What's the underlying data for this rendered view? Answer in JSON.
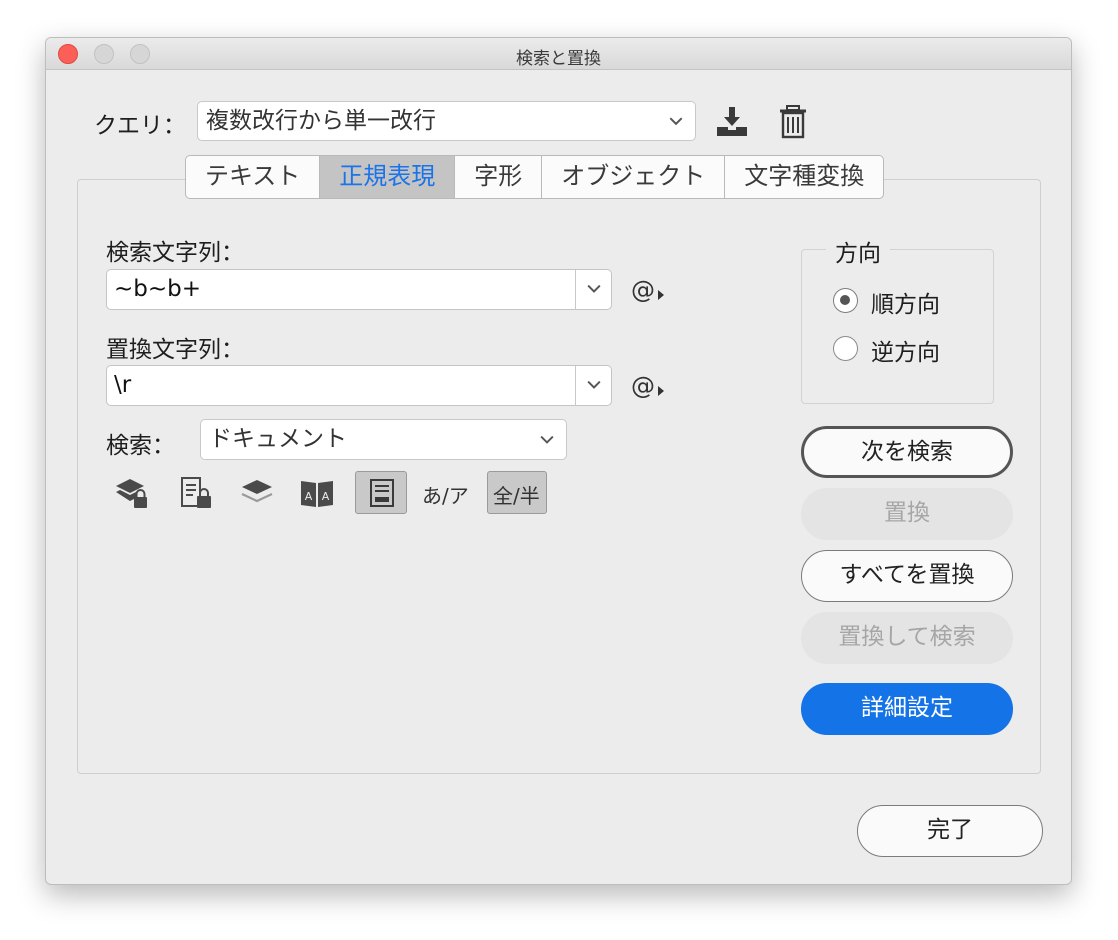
{
  "window": {
    "title": "検索と置換"
  },
  "query": {
    "label": "クエリ：",
    "value": "複数改行から単一改行",
    "save_icon": "save-download-icon",
    "delete_icon": "trash-icon"
  },
  "tabs": [
    {
      "label": "テキスト",
      "active": false
    },
    {
      "label": "正規表現",
      "active": true
    },
    {
      "label": "字形",
      "active": false
    },
    {
      "label": "オブジェクト",
      "active": false
    },
    {
      "label": "文字種変換",
      "active": false
    }
  ],
  "find": {
    "label": "検索文字列：",
    "value": "~b~b+",
    "special_chars": "@"
  },
  "replace": {
    "label": "置換文字列：",
    "value": "\\r",
    "special_chars": "@"
  },
  "search": {
    "label": "検索：",
    "value": "ドキュメント"
  },
  "options": {
    "kana_label": "あ/ア",
    "width_label": "全/半",
    "icons": [
      "locked-layers-icon",
      "locked-stories-icon",
      "hidden-layers-icon",
      "master-pages-icon",
      "footnotes-icon"
    ]
  },
  "direction": {
    "title": "方向",
    "forward": "順方向",
    "backward": "逆方向",
    "selected": "forward"
  },
  "buttons": {
    "find_next": "次を検索",
    "replace": "置換",
    "replace_all": "すべてを置換",
    "replace_find": "置換して検索",
    "advanced": "詳細設定",
    "done": "完了"
  },
  "colors": {
    "accent": "#1473e6",
    "close": "#fc5f57"
  }
}
